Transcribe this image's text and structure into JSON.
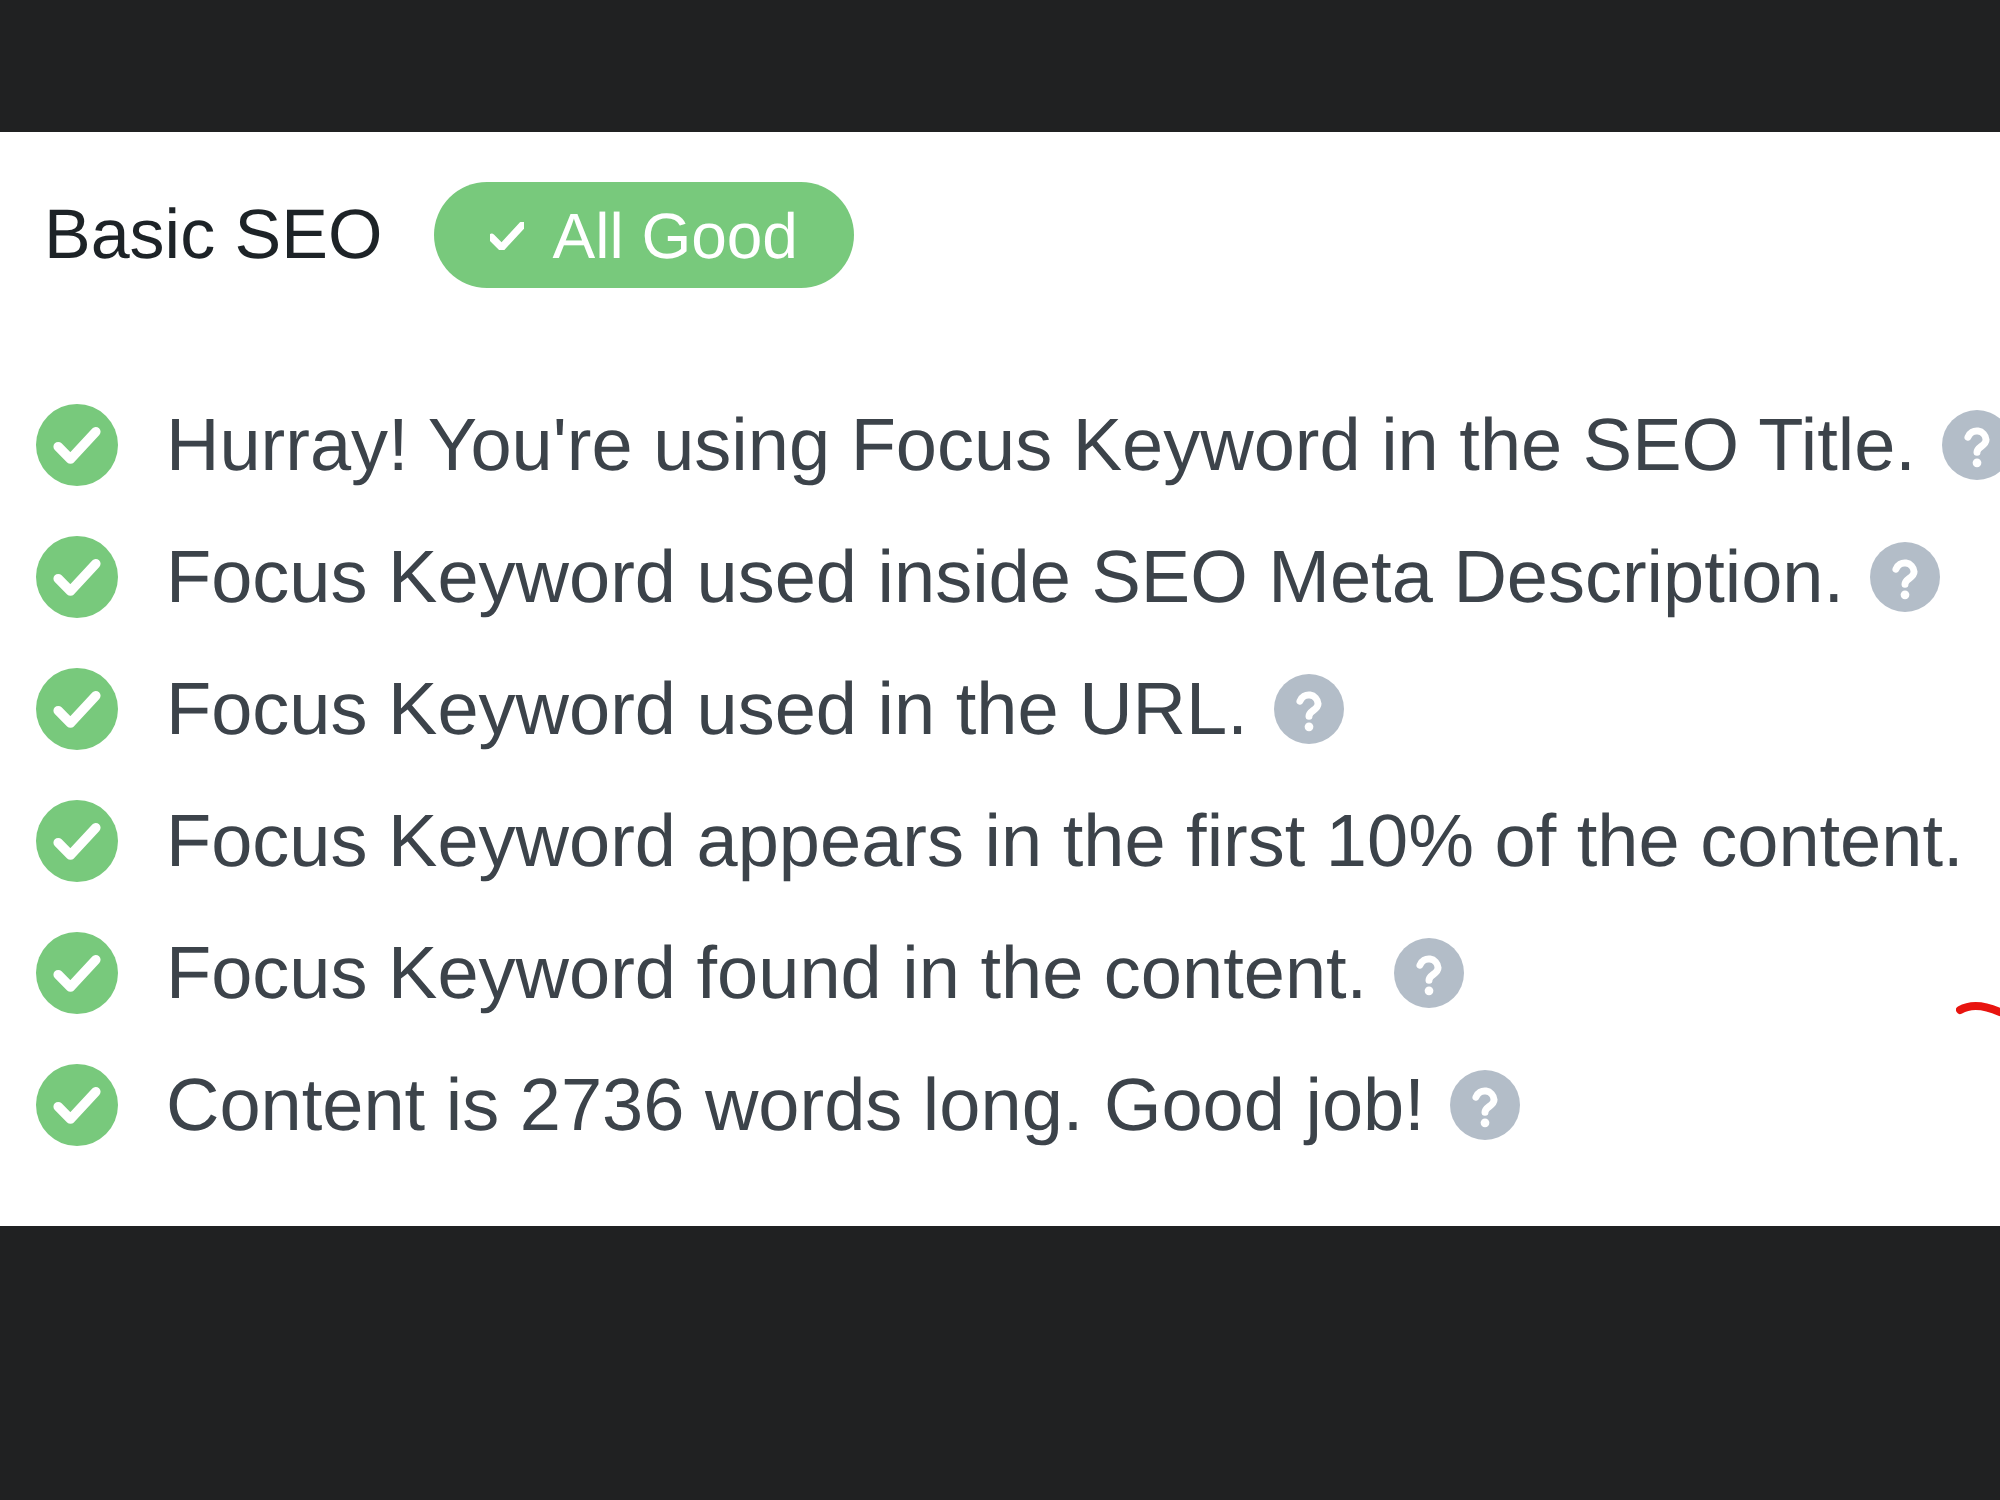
{
  "section": {
    "title": "Basic SEO",
    "status": {
      "label": "All Good",
      "kind": "good"
    }
  },
  "checks": [
    {
      "text": "Hurray! You're using Focus Keyword in the SEO Title.",
      "passed": true,
      "help_icon": true
    },
    {
      "text": "Focus Keyword used inside SEO Meta Description.",
      "passed": true,
      "help_icon": true
    },
    {
      "text": "Focus Keyword used in the URL.",
      "passed": true,
      "help_icon": true
    },
    {
      "text": "Focus Keyword appears in the first 10% of the content.",
      "passed": true,
      "help_icon": false
    },
    {
      "text": "Focus Keyword found in the content.",
      "passed": true,
      "help_icon": true
    },
    {
      "text": "Content is 2736 words long. Good job!",
      "passed": true,
      "help_icon": true
    }
  ]
}
